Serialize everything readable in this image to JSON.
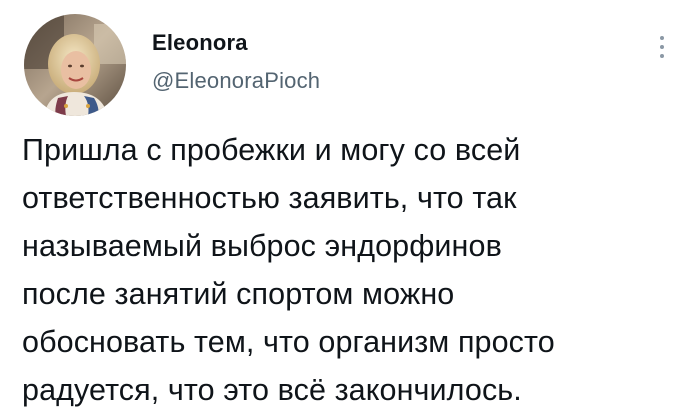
{
  "author": {
    "display_name": "Eleonora",
    "handle": "@EleonoraPioch"
  },
  "icons": {
    "avatar": "profile-photo",
    "more": "more-options-vertical-icon"
  },
  "tweet": {
    "text": "Пришла с пробежки и могу со всей\nответственностью заявить, что так\nназываемый выброс эндорфинов\nпосле занятий  спортом можно\nобосновать тем, что организм просто\nрадуется, что это всё закончилось."
  },
  "colors": {
    "text": "#0f1419",
    "secondary": "#536471",
    "background": "#ffffff"
  }
}
